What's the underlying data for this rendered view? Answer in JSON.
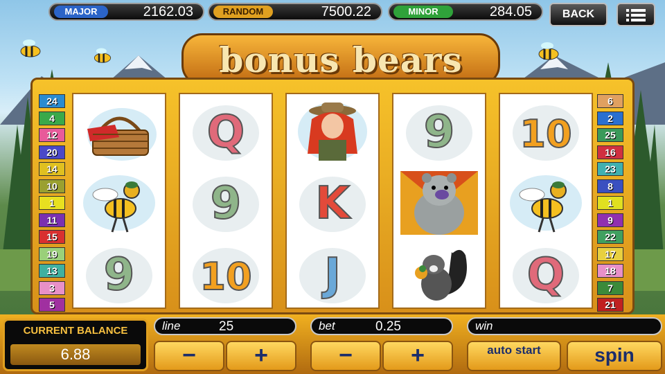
{
  "jackpots": [
    {
      "label": "MAJOR",
      "value": "2162.03",
      "color": "#2b64c8"
    },
    {
      "label": "RANDOM",
      "value": "7500.22",
      "color": "#e0a020"
    },
    {
      "label": "MINOR",
      "value": "284.05",
      "color": "#2fa23a"
    }
  ],
  "back_label": "BACK",
  "menu_icon": "menu-icon",
  "game_title": "bonus bears",
  "left_lines": [
    "24",
    "4",
    "12",
    "20",
    "14",
    "10",
    "1",
    "11",
    "15",
    "19",
    "13",
    "3",
    "5"
  ],
  "left_line_colors": [
    "#2a8bd0",
    "#3aa94a",
    "#e85a9a",
    "#4a48c8",
    "#e0c020",
    "#9aa030",
    "#e8e020",
    "#7a30b0",
    "#d83030",
    "#9ad07a",
    "#40b0a0",
    "#e890c8",
    "#a030a0"
  ],
  "right_lines": [
    "6",
    "2",
    "25",
    "16",
    "23",
    "8",
    "1",
    "9",
    "22",
    "17",
    "18",
    "7",
    "21"
  ],
  "right_line_colors": [
    "#e0a060",
    "#2a70d0",
    "#3a9a5a",
    "#d03040",
    "#40b0b0",
    "#3a50c0",
    "#e0e020",
    "#9030b0",
    "#40a060",
    "#e8d040",
    "#e890c8",
    "#3a8a3a",
    "#c02020"
  ],
  "reels": [
    [
      "picnic-basket",
      "bee",
      "9"
    ],
    [
      "Q",
      "9",
      "10"
    ],
    [
      "ranger-girl",
      "K",
      "J"
    ],
    [
      "9",
      "bear",
      "skunk"
    ],
    [
      "10",
      "bee",
      "Q"
    ]
  ],
  "balance": {
    "label": "CURRENT BALANCE",
    "value": "6.88"
  },
  "line": {
    "label": "line",
    "value": "25"
  },
  "bet": {
    "label": "bet",
    "value": "0.25"
  },
  "win": {
    "label": "win",
    "value": ""
  },
  "buttons": {
    "minus": "−",
    "plus": "+",
    "auto_start": "auto start",
    "spin": "spin"
  }
}
